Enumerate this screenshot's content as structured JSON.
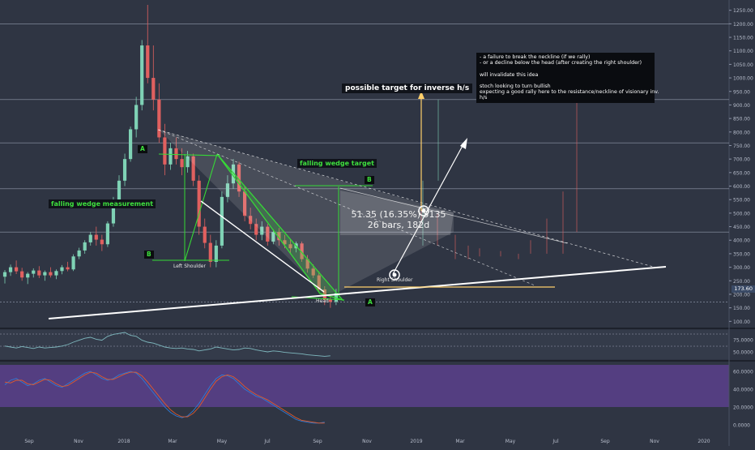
{
  "colors": {
    "background": "#2f3543",
    "panel": "#353b4b",
    "up": "#7fd2b5",
    "down": "#e0605f",
    "green_line": "#36d936",
    "white_line": "#ffffff",
    "target_line": "#ffcf6b",
    "rsi_line": "#7fb9bf",
    "stoch_k": "#2f7bd6",
    "stoch_d": "#e35a2a",
    "stoch_band": "#5b3f8c"
  },
  "annotations": {
    "invalidate_note": "- a failure to break the neckline (if we rally)\n- or a decline below the head (after creating the right shoulder)\n\nwill invalidate this idea\n\nstoch looking to turn bullish\nexpecting a good rally here to the resistance/neckline of visionary inv.\nh/s",
    "target_label": "possible target for inverse h/s",
    "wedge_target": "falling wedge target",
    "wedge_measure": "falling wedge measurement",
    "measure_line1": "51.35 (16.35%) 5135",
    "measure_line2": "26 bars, 182d",
    "left_shoulder": "Left Shoulder",
    "right_shoulder": "Right Shoulder",
    "head": "Head",
    "a_top": "A",
    "b_left": "B",
    "b_right": "B",
    "a_bottom": "A"
  },
  "chart_data": [
    {
      "type": "candlestick",
      "title": "",
      "x_tick_labels": [
        "Sep",
        "Nov",
        "2018",
        "Mar",
        "May",
        "Jul",
        "Sep",
        "Nov",
        "2019",
        "Mar",
        "May",
        "Jul",
        "Sep",
        "Nov",
        "2020"
      ],
      "y_tick_labels": [
        "1250.00",
        "1200.00",
        "1150.00",
        "1100.00",
        "1050.00",
        "1000.00",
        "950.00",
        "900.00",
        "850.00",
        "800.00",
        "750.00",
        "700.00",
        "650.00",
        "600.00",
        "550.00",
        "500.00",
        "450.00",
        "400.00",
        "350.00",
        "300.00",
        "250.00",
        "200.00",
        "150.00",
        "100.00"
      ],
      "ylim": [
        80,
        1270
      ],
      "current_price": "173.60",
      "candles": [
        {
          "o": 265,
          "h": 290,
          "l": 240,
          "c": 282
        },
        {
          "o": 282,
          "h": 310,
          "l": 268,
          "c": 300
        },
        {
          "o": 300,
          "h": 325,
          "l": 275,
          "c": 285
        },
        {
          "o": 285,
          "h": 298,
          "l": 250,
          "c": 262
        },
        {
          "o": 262,
          "h": 282,
          "l": 238,
          "c": 276
        },
        {
          "o": 276,
          "h": 296,
          "l": 262,
          "c": 288
        },
        {
          "o": 288,
          "h": 304,
          "l": 260,
          "c": 270
        },
        {
          "o": 270,
          "h": 288,
          "l": 250,
          "c": 282
        },
        {
          "o": 282,
          "h": 300,
          "l": 262,
          "c": 270
        },
        {
          "o": 270,
          "h": 292,
          "l": 256,
          "c": 286
        },
        {
          "o": 286,
          "h": 308,
          "l": 274,
          "c": 300
        },
        {
          "o": 300,
          "h": 320,
          "l": 285,
          "c": 292
        },
        {
          "o": 292,
          "h": 348,
          "l": 286,
          "c": 340
        },
        {
          "o": 340,
          "h": 372,
          "l": 330,
          "c": 362
        },
        {
          "o": 362,
          "h": 400,
          "l": 350,
          "c": 392
        },
        {
          "o": 392,
          "h": 430,
          "l": 380,
          "c": 420
        },
        {
          "o": 420,
          "h": 450,
          "l": 380,
          "c": 402
        },
        {
          "o": 402,
          "h": 420,
          "l": 360,
          "c": 385
        },
        {
          "o": 385,
          "h": 470,
          "l": 375,
          "c": 462
        },
        {
          "o": 462,
          "h": 560,
          "l": 450,
          "c": 548
        },
        {
          "o": 548,
          "h": 640,
          "l": 530,
          "c": 620
        },
        {
          "o": 620,
          "h": 720,
          "l": 600,
          "c": 700
        },
        {
          "o": 700,
          "h": 820,
          "l": 690,
          "c": 810
        },
        {
          "o": 810,
          "h": 930,
          "l": 780,
          "c": 900
        },
        {
          "o": 900,
          "h": 1140,
          "l": 880,
          "c": 1120
        },
        {
          "o": 1120,
          "h": 1270,
          "l": 980,
          "c": 1000
        },
        {
          "o": 1000,
          "h": 1120,
          "l": 880,
          "c": 920
        },
        {
          "o": 920,
          "h": 980,
          "l": 760,
          "c": 780
        },
        {
          "o": 780,
          "h": 830,
          "l": 640,
          "c": 680
        },
        {
          "o": 680,
          "h": 760,
          "l": 660,
          "c": 740
        },
        {
          "o": 740,
          "h": 780,
          "l": 680,
          "c": 700
        },
        {
          "o": 700,
          "h": 740,
          "l": 640,
          "c": 670
        },
        {
          "o": 670,
          "h": 730,
          "l": 650,
          "c": 710
        },
        {
          "o": 710,
          "h": 720,
          "l": 600,
          "c": 620
        },
        {
          "o": 620,
          "h": 640,
          "l": 420,
          "c": 450
        },
        {
          "o": 450,
          "h": 480,
          "l": 370,
          "c": 390
        },
        {
          "o": 390,
          "h": 420,
          "l": 300,
          "c": 320
        },
        {
          "o": 320,
          "h": 400,
          "l": 300,
          "c": 380
        },
        {
          "o": 380,
          "h": 580,
          "l": 370,
          "c": 560
        },
        {
          "o": 560,
          "h": 640,
          "l": 540,
          "c": 610
        },
        {
          "o": 610,
          "h": 700,
          "l": 590,
          "c": 680
        },
        {
          "o": 680,
          "h": 690,
          "l": 560,
          "c": 580
        },
        {
          "o": 580,
          "h": 600,
          "l": 470,
          "c": 490
        },
        {
          "o": 490,
          "h": 520,
          "l": 440,
          "c": 460
        },
        {
          "o": 460,
          "h": 480,
          "l": 400,
          "c": 420
        },
        {
          "o": 420,
          "h": 470,
          "l": 400,
          "c": 450
        },
        {
          "o": 450,
          "h": 460,
          "l": 380,
          "c": 395
        },
        {
          "o": 395,
          "h": 440,
          "l": 385,
          "c": 430
        },
        {
          "o": 430,
          "h": 445,
          "l": 380,
          "c": 400
        },
        {
          "o": 400,
          "h": 420,
          "l": 370,
          "c": 385
        },
        {
          "o": 385,
          "h": 405,
          "l": 350,
          "c": 370
        },
        {
          "o": 370,
          "h": 395,
          "l": 355,
          "c": 388
        },
        {
          "o": 388,
          "h": 395,
          "l": 320,
          "c": 330
        },
        {
          "o": 330,
          "h": 345,
          "l": 280,
          "c": 295
        },
        {
          "o": 295,
          "h": 310,
          "l": 260,
          "c": 270
        },
        {
          "o": 270,
          "h": 285,
          "l": 205,
          "c": 218
        },
        {
          "o": 218,
          "h": 230,
          "l": 160,
          "c": 180
        },
        {
          "o": 180,
          "h": 200,
          "l": 150,
          "c": 172
        },
        {
          "o": 172,
          "h": 220,
          "l": 160,
          "c": 205
        }
      ]
    },
    {
      "type": "line",
      "title": "",
      "y_tick_labels": [
        "75.0000",
        "50.0000"
      ],
      "ylim": [
        35,
        95
      ],
      "series": [
        {
          "values": [
            62,
            60,
            58,
            61,
            59,
            57,
            60,
            58,
            59,
            60,
            62,
            65,
            70,
            74,
            78,
            80,
            76,
            74,
            82,
            86,
            88,
            90,
            84,
            82,
            74,
            70,
            68,
            64,
            60,
            58,
            57,
            58,
            56,
            55,
            52,
            54,
            56,
            60,
            58,
            56,
            54,
            55,
            58,
            57,
            54,
            52,
            50,
            52,
            51,
            49,
            48,
            47,
            46,
            44,
            43,
            42,
            41,
            42
          ]
        }
      ]
    },
    {
      "type": "line",
      "title": "",
      "y_tick_labels": [
        "60.0000",
        "40.0000",
        "20.0000",
        "0.0000"
      ],
      "ylim": [
        -10,
        70
      ],
      "series": [
        {
          "values": [
            45,
            50,
            52,
            48,
            44,
            46,
            50,
            52,
            48,
            44,
            42,
            46,
            50,
            54,
            58,
            60,
            56,
            52,
            50,
            52,
            56,
            58,
            60,
            58,
            52,
            44,
            36,
            28,
            20,
            14,
            10,
            8,
            10,
            16,
            24,
            34,
            44,
            52,
            56,
            55,
            52,
            46,
            40,
            36,
            32,
            30,
            26,
            22,
            18,
            14,
            10,
            6,
            4,
            3,
            2,
            2,
            3
          ]
        },
        {
          "values": [
            48,
            47,
            50,
            50,
            46,
            45,
            48,
            51,
            50,
            46,
            43,
            44,
            48,
            52,
            56,
            59,
            58,
            54,
            51,
            51,
            54,
            57,
            59,
            59,
            55,
            48,
            40,
            32,
            24,
            17,
            12,
            9,
            9,
            13,
            20,
            30,
            40,
            49,
            54,
            56,
            54,
            49,
            43,
            38,
            34,
            31,
            28,
            24,
            20,
            16,
            12,
            8,
            5,
            4,
            3,
            2,
            2
          ]
        }
      ]
    }
  ]
}
